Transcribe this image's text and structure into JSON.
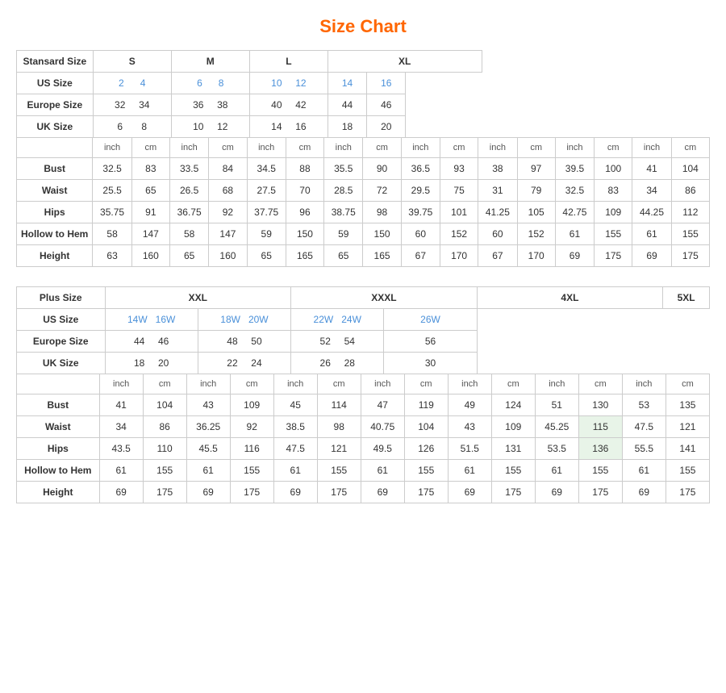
{
  "title": "Size Chart",
  "standard": {
    "table_label": "Stansard Size",
    "size_groups": [
      "S",
      "M",
      "L",
      "XL"
    ],
    "us_label": "US Size",
    "europe_label": "Europe Size",
    "uk_label": "UK Size",
    "us_sizes": [
      "2",
      "4",
      "6",
      "8",
      "10",
      "12",
      "14",
      "16"
    ],
    "europe_sizes": [
      "32",
      "34",
      "36",
      "38",
      "40",
      "42",
      "44",
      "46"
    ],
    "uk_sizes": [
      "6",
      "8",
      "10",
      "12",
      "14",
      "16",
      "18",
      "20"
    ],
    "subheader": [
      "inch",
      "cm",
      "inch",
      "cm",
      "inch",
      "cm",
      "inch",
      "cm",
      "inch",
      "cm",
      "inch",
      "cm",
      "inch",
      "cm",
      "inch",
      "cm"
    ],
    "measurements": {
      "Bust": [
        "32.5",
        "83",
        "33.5",
        "84",
        "34.5",
        "88",
        "35.5",
        "90",
        "36.5",
        "93",
        "38",
        "97",
        "39.5",
        "100",
        "41",
        "104"
      ],
      "Waist": [
        "25.5",
        "65",
        "26.5",
        "68",
        "27.5",
        "70",
        "28.5",
        "72",
        "29.5",
        "75",
        "31",
        "79",
        "32.5",
        "83",
        "34",
        "86"
      ],
      "Hips": [
        "35.75",
        "91",
        "36.75",
        "92",
        "37.75",
        "96",
        "38.75",
        "98",
        "39.75",
        "101",
        "41.25",
        "105",
        "42.75",
        "109",
        "44.25",
        "112"
      ],
      "Hollow to Hem": [
        "58",
        "147",
        "58",
        "147",
        "59",
        "150",
        "59",
        "150",
        "60",
        "152",
        "60",
        "152",
        "61",
        "155",
        "61",
        "155"
      ],
      "Height": [
        "63",
        "160",
        "65",
        "160",
        "65",
        "165",
        "65",
        "165",
        "67",
        "170",
        "67",
        "170",
        "69",
        "175",
        "69",
        "175"
      ]
    }
  },
  "plus": {
    "table_label": "Plus Size",
    "size_groups": [
      "XXL",
      "XXXL",
      "4XL",
      "5XL"
    ],
    "us_label": "US Size",
    "europe_label": "Europe Size",
    "uk_label": "UK Size",
    "us_sizes": [
      "14W",
      "16W",
      "18W",
      "20W",
      "22W",
      "24W",
      "26W"
    ],
    "europe_sizes": [
      "44",
      "46",
      "48",
      "50",
      "52",
      "54",
      "56"
    ],
    "uk_sizes": [
      "18",
      "20",
      "22",
      "24",
      "26",
      "28",
      "30"
    ],
    "subheader": [
      "inch",
      "cm",
      "inch",
      "cm",
      "inch",
      "cm",
      "inch",
      "cm",
      "inch",
      "cm",
      "inch",
      "cm",
      "inch",
      "cm"
    ],
    "measurements": {
      "Bust": [
        "41",
        "104",
        "43",
        "109",
        "45",
        "114",
        "47",
        "119",
        "49",
        "124",
        "51",
        "130",
        "53",
        "135"
      ],
      "Waist": [
        "34",
        "86",
        "36.25",
        "92",
        "38.5",
        "98",
        "40.75",
        "104",
        "43",
        "109",
        "45.25",
        "115",
        "47.5",
        "121"
      ],
      "Hips": [
        "43.5",
        "110",
        "45.5",
        "116",
        "47.5",
        "121",
        "49.5",
        "126",
        "51.5",
        "131",
        "53.5",
        "136",
        "55.5",
        "141"
      ],
      "Hollow to Hem": [
        "61",
        "155",
        "61",
        "155",
        "61",
        "155",
        "61",
        "155",
        "61",
        "155",
        "61",
        "155",
        "61",
        "155"
      ],
      "Height": [
        "69",
        "175",
        "69",
        "175",
        "69",
        "175",
        "69",
        "175",
        "69",
        "175",
        "69",
        "175",
        "69",
        "175"
      ]
    }
  }
}
